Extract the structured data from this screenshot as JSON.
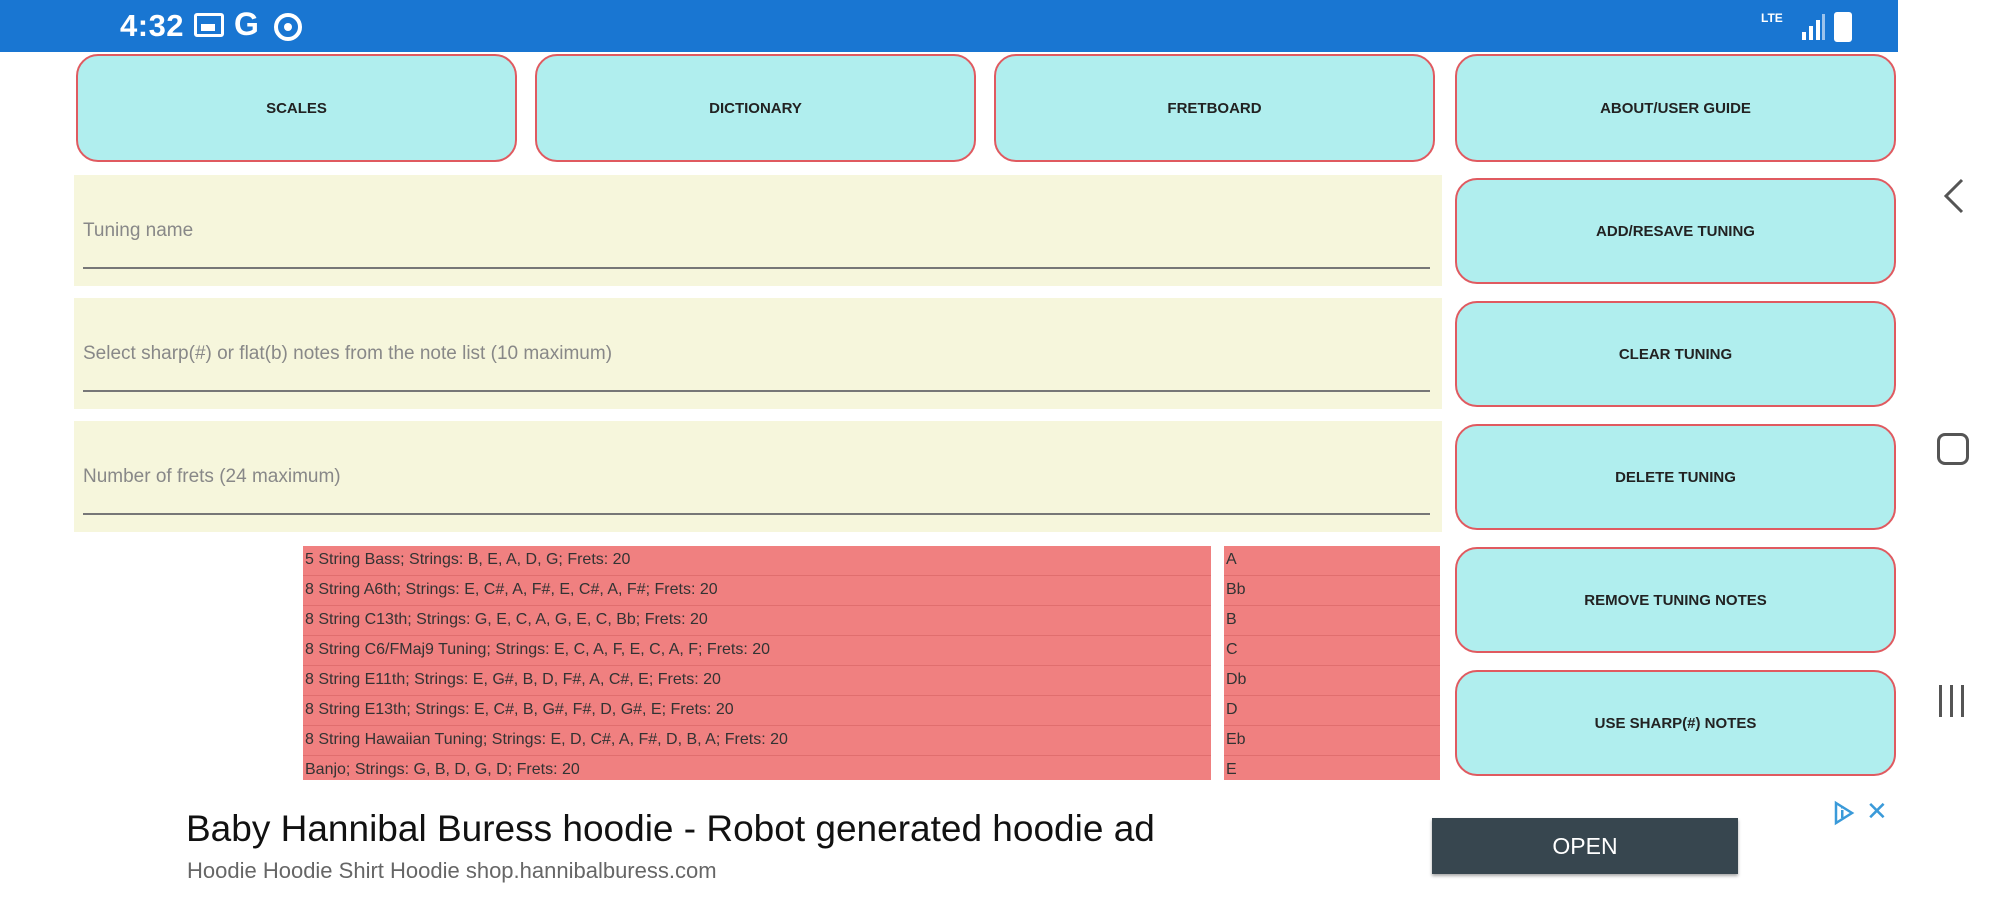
{
  "status_bar": {
    "time": "4:32",
    "carrier_letter": "G",
    "network_label": "LTE"
  },
  "tabs": [
    {
      "label": "SCALES"
    },
    {
      "label": "DICTIONARY"
    },
    {
      "label": "FRETBOARD"
    },
    {
      "label": "ABOUT/USER GUIDE"
    }
  ],
  "form": {
    "tuning_name_placeholder": "Tuning name",
    "notes_placeholder": "Select sharp(#) or flat(b) notes from the note list (10 maximum)",
    "frets_placeholder": "Number of frets (24 maximum)"
  },
  "actions": {
    "add_resave": "ADD/RESAVE TUNING",
    "clear": "CLEAR TUNING",
    "delete": "DELETE TUNING",
    "remove_notes": "REMOVE TUNING NOTES",
    "use_sharp": "USE SHARP(#) NOTES"
  },
  "tunings": [
    "5 String Bass;  Strings: B, E, A, D, G;  Frets: 20",
    "8 String A6th;  Strings: E, C#, A, F#, E, C#, A, F#;  Frets: 20",
    "8 String C13th;  Strings: G, E, C, A, G, E, C, Bb;  Frets: 20",
    "8 String C6/FMaj9 Tuning;  Strings: E, C, A, F, E, C, A, F;  Frets: 20",
    "8 String E11th;  Strings: E, G#, B, D, F#, A, C#, E;  Frets: 20",
    "8 String E13th;  Strings: E, C#, B, G#, F#, D, G#, E;  Frets: 20",
    "8 String Hawaiian Tuning;  Strings: E, D, C#, A, F#, D, B, A;  Frets: 20",
    "Banjo;  Strings: G, B, D, G, D;  Frets: 20"
  ],
  "notes": [
    "A",
    "Bb",
    "B",
    "C",
    "Db",
    "D",
    "Eb",
    "E"
  ],
  "ad": {
    "title": "Baby Hannibal Buress hoodie - Robot generated hoodie ad",
    "subtitle": "Hoodie Hoodie Shirt Hoodie shop.hannibalburess.com",
    "open_label": "OPEN",
    "close_glyph": "✕"
  },
  "colors": {
    "status_bar": "#1976d2",
    "button_fill": "#b0eeee",
    "button_border": "#e05a60",
    "field_bg": "#f6f6dc",
    "list_bg": "#f08080",
    "ad_button": "#37464f"
  }
}
